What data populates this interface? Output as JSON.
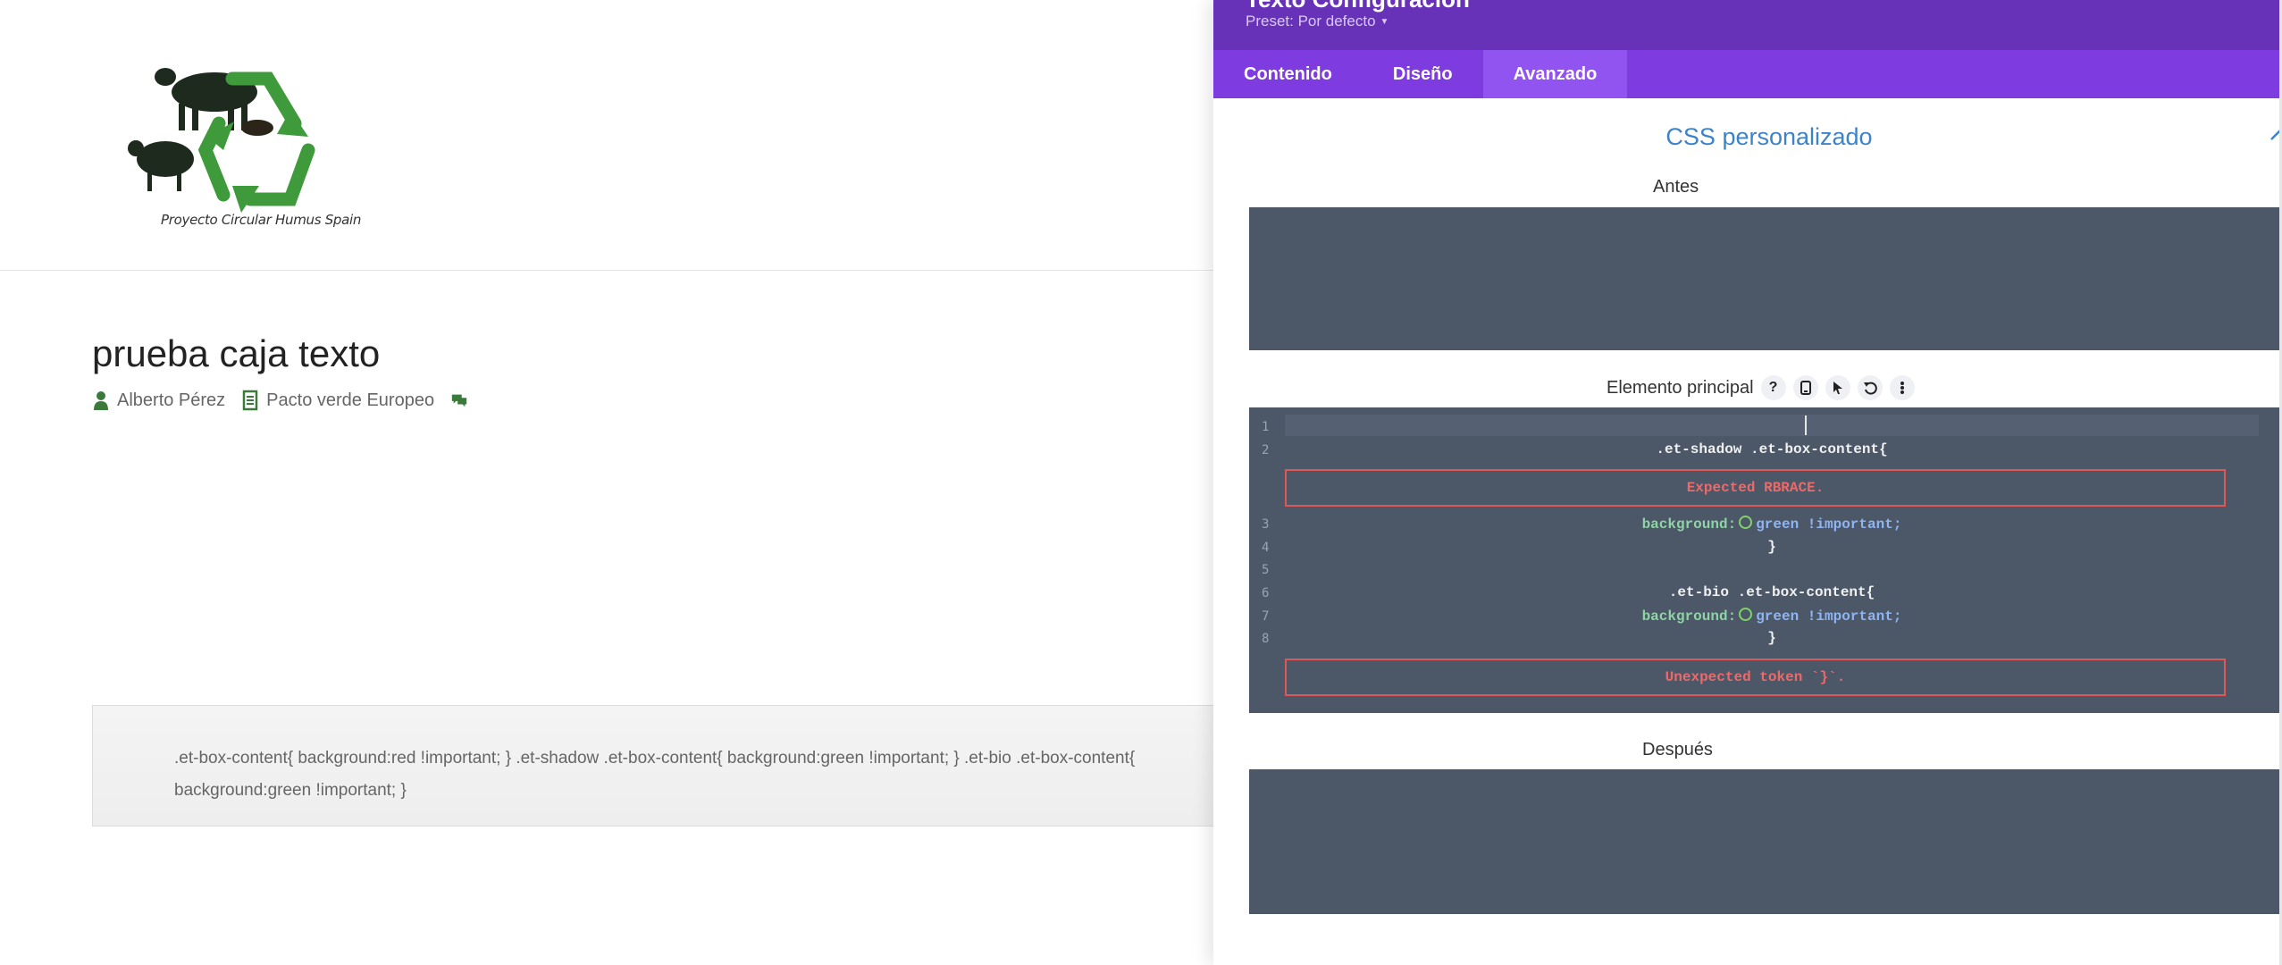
{
  "site": {
    "logo_text": "Proyecto Circular Humus Spain",
    "post_title": "prueba caja texto",
    "meta": {
      "author": "Alberto Pérez",
      "category": "Pacto verde Europeo"
    },
    "text_box_content": ".et-box-content{ background:red !important; } .et-shadow .et-box-content{ background:green !important; } .et-bio .et-box-content{ background:green !important; }"
  },
  "panel": {
    "title": "Texto Configuración",
    "preset_label": "Preset: Por defecto",
    "tabs": [
      {
        "label": "Contenido",
        "active": false
      },
      {
        "label": "Diseño",
        "active": false
      },
      {
        "label": "Avanzado",
        "active": true
      }
    ],
    "section_title": "CSS personalizado",
    "before_label": "Antes",
    "main_label": "Elemento principal",
    "main_tools": [
      "?",
      "mobile-icon",
      "pointer-icon",
      "reset-icon",
      "more-icon"
    ],
    "after_label": "Después",
    "code": {
      "line_numbers": [
        "1",
        "2",
        "3",
        "4",
        "5",
        "6",
        "7",
        "8"
      ],
      "line2": ".et-shadow .et-box-content{",
      "error1": "Expected RBRACE.",
      "line3_prop": "background:",
      "line3_val": "green !important;",
      "line4": "}",
      "line6": ".et-bio .et-box-content{",
      "line7_prop": "background:",
      "line7_val": "green !important;",
      "line8": "}",
      "error2": "Unexpected token `}`."
    },
    "colors": {
      "header": "#6832b8",
      "tabs": "#7d3be0",
      "tab_active": "#9254f0",
      "editor_bg": "#4c5767",
      "error": "#e05757",
      "link_blue": "#3d83c9"
    }
  }
}
